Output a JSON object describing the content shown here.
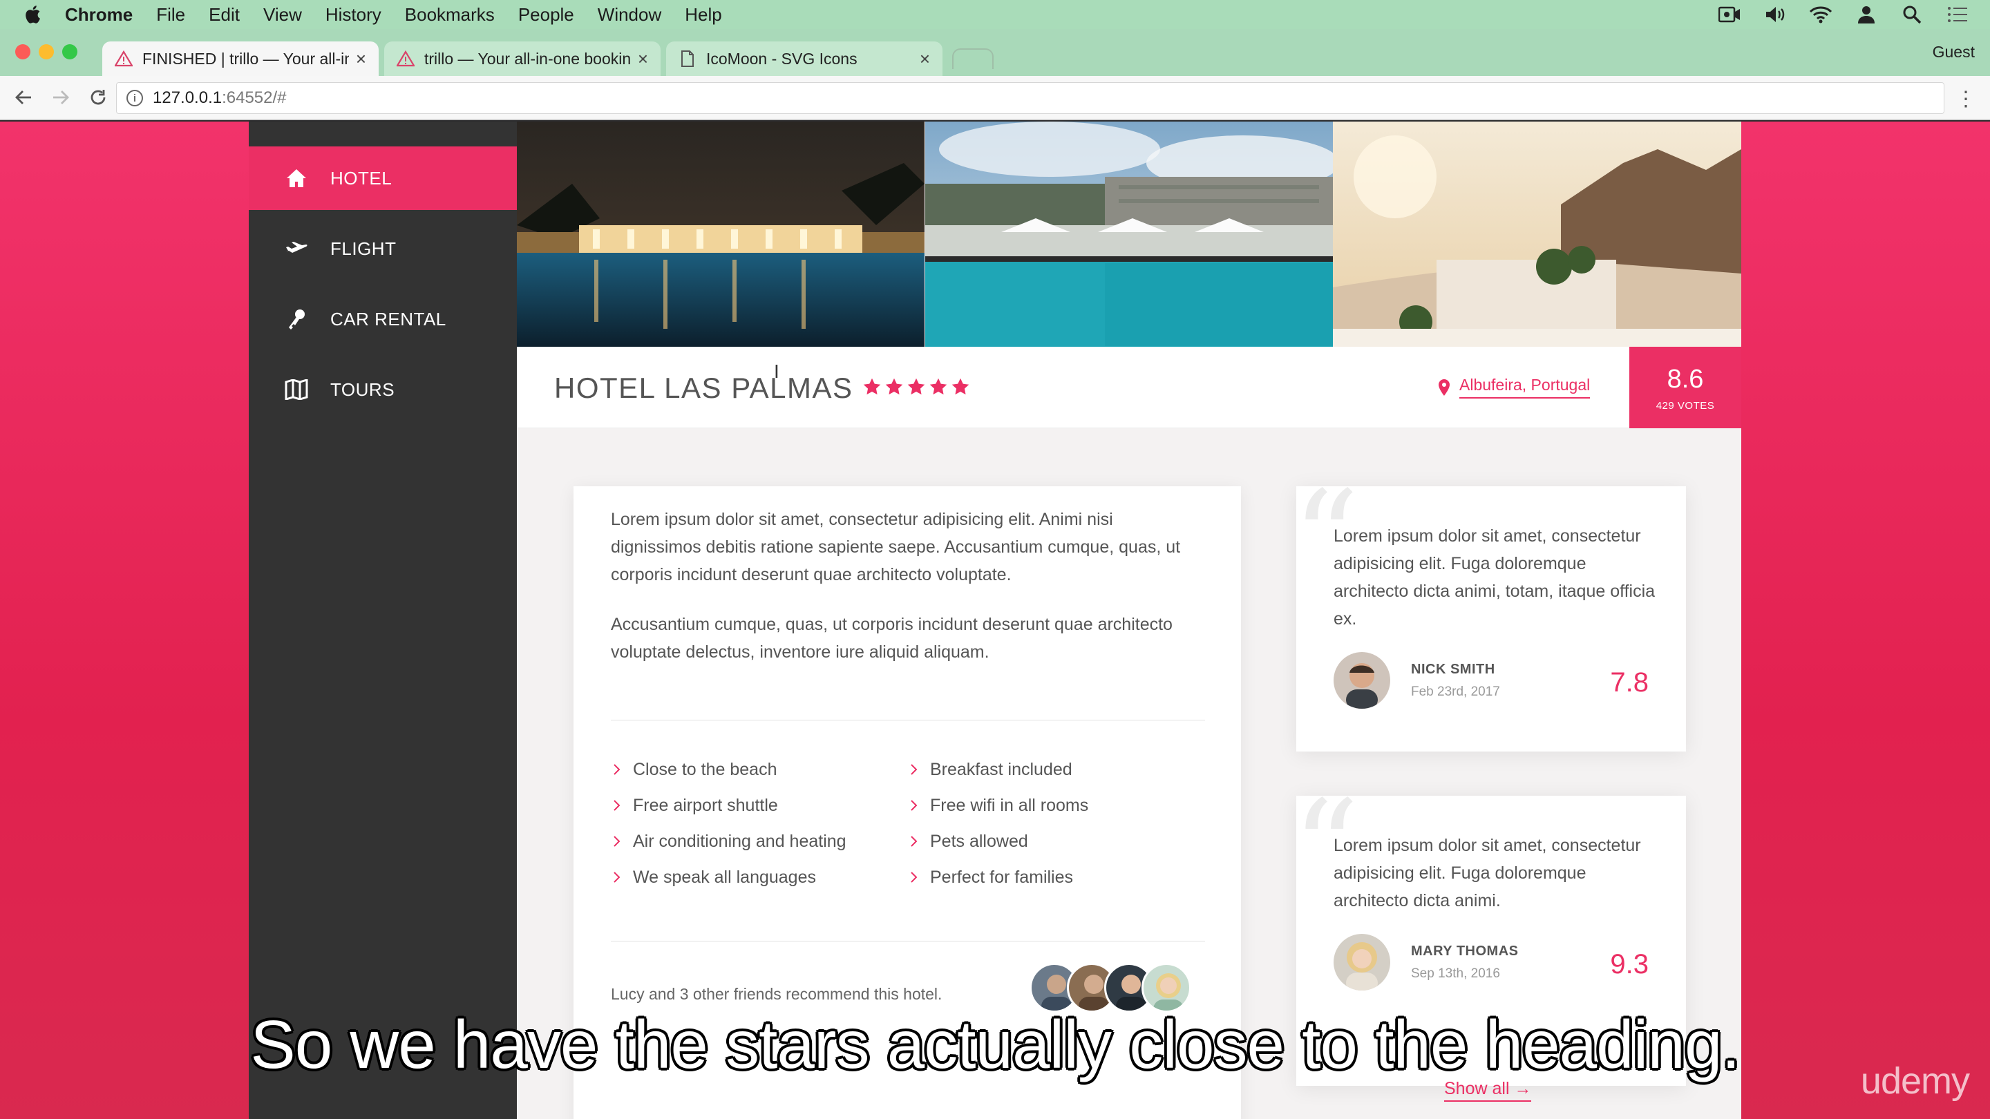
{
  "os_menu": {
    "app": "Chrome",
    "items": [
      "File",
      "Edit",
      "View",
      "History",
      "Bookmarks",
      "People",
      "Window",
      "Help"
    ]
  },
  "browser": {
    "tabs": [
      {
        "title": "FINISHED | trillo — Your all-in-"
      },
      {
        "title": "trillo — Your all-in-one bookin"
      },
      {
        "title": "IcoMoon - SVG Icons"
      }
    ],
    "profile": "Guest",
    "url_host": "127.0.0.1",
    "url_rest": ":64552/#"
  },
  "sidebar": {
    "items": [
      {
        "label": "HOTEL",
        "icon": "home-icon"
      },
      {
        "label": "FLIGHT",
        "icon": "airplane-icon"
      },
      {
        "label": "CAR RENTAL",
        "icon": "key-icon"
      },
      {
        "label": "TOURS",
        "icon": "map-icon"
      }
    ]
  },
  "hotel": {
    "name": "HOTEL LAS PALMAS",
    "stars": 5,
    "location": "Albufeira, Portugal",
    "rating": "8.6",
    "votes": "429 VOTES"
  },
  "description": {
    "p1": "Lorem ipsum dolor sit amet, consectetur adipisicing elit. Animi nisi dignissimos debitis ratione sapiente saepe. Accusantium cumque, quas, ut corporis incidunt deserunt quae architecto voluptate.",
    "p2": "Accusantium cumque, quas, ut corporis incidunt deserunt quae architecto voluptate delectus, inventore iure aliquid aliquam.",
    "features": [
      "Close to the beach",
      "Free airport shuttle",
      "Air conditioning and heating",
      "We speak all languages",
      "Breakfast included",
      "Free wifi in all rooms",
      "Pets allowed",
      "Perfect for families"
    ],
    "recommend": "Lucy and 3 other friends recommend this hotel."
  },
  "reviews": [
    {
      "text": "Lorem ipsum dolor sit amet, consectetur adipisicing elit. Fuga doloremque architecto dicta animi, totam, itaque officia ex.",
      "name": "NICK SMITH",
      "date": "Feb 23rd, 2017",
      "score": "7.8"
    },
    {
      "text": "Lorem ipsum dolor sit amet, consectetur adipisicing elit. Fuga doloremque architecto dicta animi.",
      "name": "MARY THOMAS",
      "date": "Sep 13th, 2016",
      "score": "9.3"
    }
  ],
  "show_all": "Show all",
  "subtitle": "So we have the stars actually close to the heading.",
  "watermark": "udemy",
  "colors": {
    "primary": "#eb2f64",
    "sidebar": "#333333",
    "menubar": "#a9dcb9"
  }
}
